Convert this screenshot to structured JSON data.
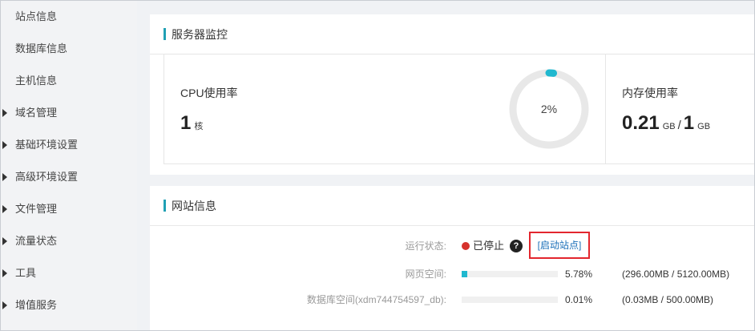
{
  "sidebar": {
    "items": [
      {
        "label": "站点信息",
        "active": true,
        "expandable": false
      },
      {
        "label": "数据库信息",
        "active": false,
        "expandable": false
      },
      {
        "label": "主机信息",
        "active": false,
        "expandable": false
      },
      {
        "label": "域名管理",
        "active": false,
        "expandable": true
      },
      {
        "label": "基础环境设置",
        "active": false,
        "expandable": true
      },
      {
        "label": "高级环境设置",
        "active": false,
        "expandable": true
      },
      {
        "label": "文件管理",
        "active": false,
        "expandable": true
      },
      {
        "label": "流量状态",
        "active": false,
        "expandable": true
      },
      {
        "label": "工具",
        "active": false,
        "expandable": true
      },
      {
        "label": "增值服务",
        "active": false,
        "expandable": true
      }
    ]
  },
  "server_monitor": {
    "title": "服务器监控",
    "cpu": {
      "label": "CPU使用率",
      "cores": "1",
      "cores_unit": "核",
      "usage_text": "2%",
      "usage_fraction": 0.02
    },
    "memory": {
      "label": "内存使用率",
      "used": "0.21",
      "used_unit": "GB",
      "separator": "/",
      "total": "1",
      "total_unit": "GB"
    }
  },
  "site_info": {
    "title": "网站信息",
    "run_status": {
      "label": "运行状态:",
      "value": "已停止",
      "help": "?",
      "action_label": "[启动站点]"
    },
    "web_space": {
      "label": "网页空间:",
      "percent": "5.78%",
      "fraction": 0.0578,
      "size": "(296.00MB / 5120.00MB)"
    },
    "db_space": {
      "label": "数据库空间(xdm744754597_db):",
      "percent": "0.01%",
      "fraction": 0.0001,
      "size": "(0.03MB / 500.00MB)"
    }
  },
  "colors": {
    "accent": "#20a0b4",
    "progress": "#20b8cf",
    "stopped": "#d6322c",
    "highlight": "#e3262e"
  }
}
